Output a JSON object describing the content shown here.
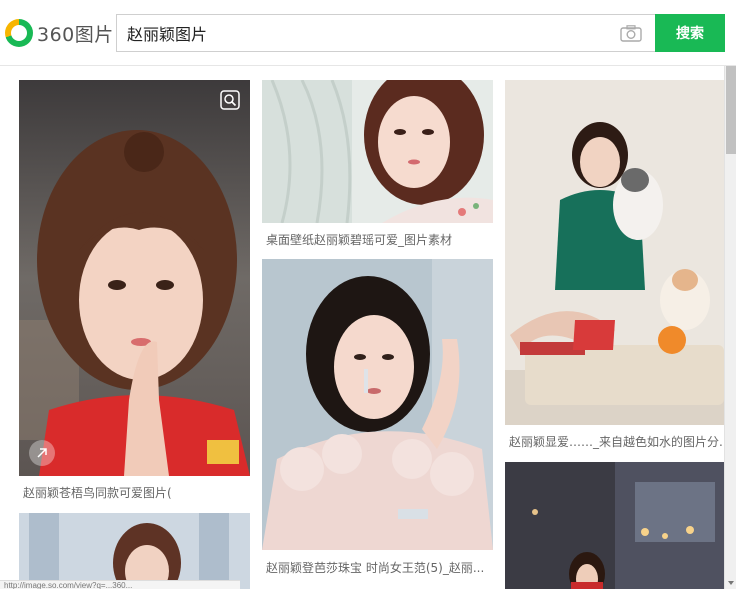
{
  "header": {
    "logo_text": "360图片",
    "search_value": "赵丽颖图片",
    "search_button": "搜索"
  },
  "colors": {
    "brand_green": "#19b955",
    "brand_yellow": "#f7b500"
  },
  "results": [
    {
      "caption": "赵丽颖苍梧鸟同款可爱图片("
    },
    {
      "caption": "桌面壁纸赵丽颖碧瑶可爱_图片素材"
    },
    {
      "caption": "赵丽颖登芭莎珠宝 时尚女王范(5)_赵丽..."
    },
    {
      "caption": "赵丽颖显爱……_来自越色如水的图片分..."
    },
    {
      "caption": ""
    },
    {
      "caption": ""
    }
  ],
  "status_text": "http://image.so.com/view?q=...360..."
}
